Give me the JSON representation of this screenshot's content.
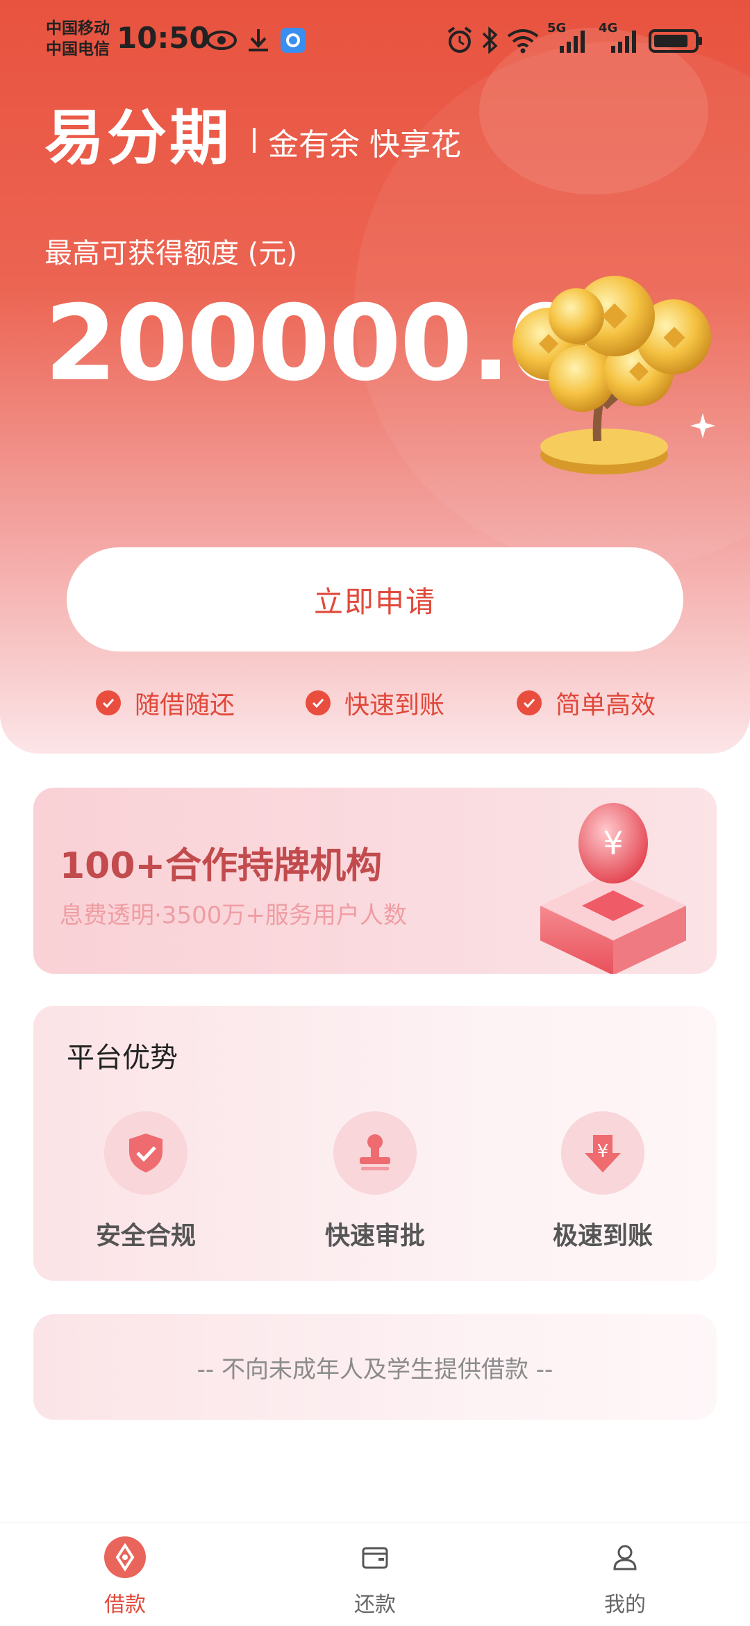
{
  "status_bar": {
    "carrier1": "中国移动",
    "carrier2": "中国电信",
    "time": "10:50",
    "net1": "5G",
    "net2": "4G"
  },
  "header": {
    "title": "易分期",
    "subtitle": "金有余 快享花"
  },
  "credit": {
    "label": "最高可获得额度 (元)",
    "amount": "200000.00"
  },
  "apply_button": "立即申请",
  "features": [
    "随借随还",
    "快速到账",
    "简单高效"
  ],
  "banner": {
    "title": "100+合作持牌机构",
    "subtitle": "息费透明·3500万+服务用户人数"
  },
  "advantages": {
    "title": "平台优势",
    "items": [
      {
        "label": "安全合规",
        "icon": "shield-check-icon"
      },
      {
        "label": "快速审批",
        "icon": "stamp-icon"
      },
      {
        "label": "极速到账",
        "icon": "yen-arrow-down-icon"
      }
    ]
  },
  "notice": "-- 不向未成年人及学生提供借款 --",
  "tabs": [
    {
      "label": "借款",
      "icon": "borrow-icon",
      "active": true
    },
    {
      "label": "还款",
      "icon": "wallet-icon",
      "active": false
    },
    {
      "label": "我的",
      "icon": "user-icon",
      "active": false
    }
  ],
  "colors": {
    "accent": "#e94d3e",
    "hero_top": "#e8533f",
    "banner_title": "#c24b4d"
  }
}
